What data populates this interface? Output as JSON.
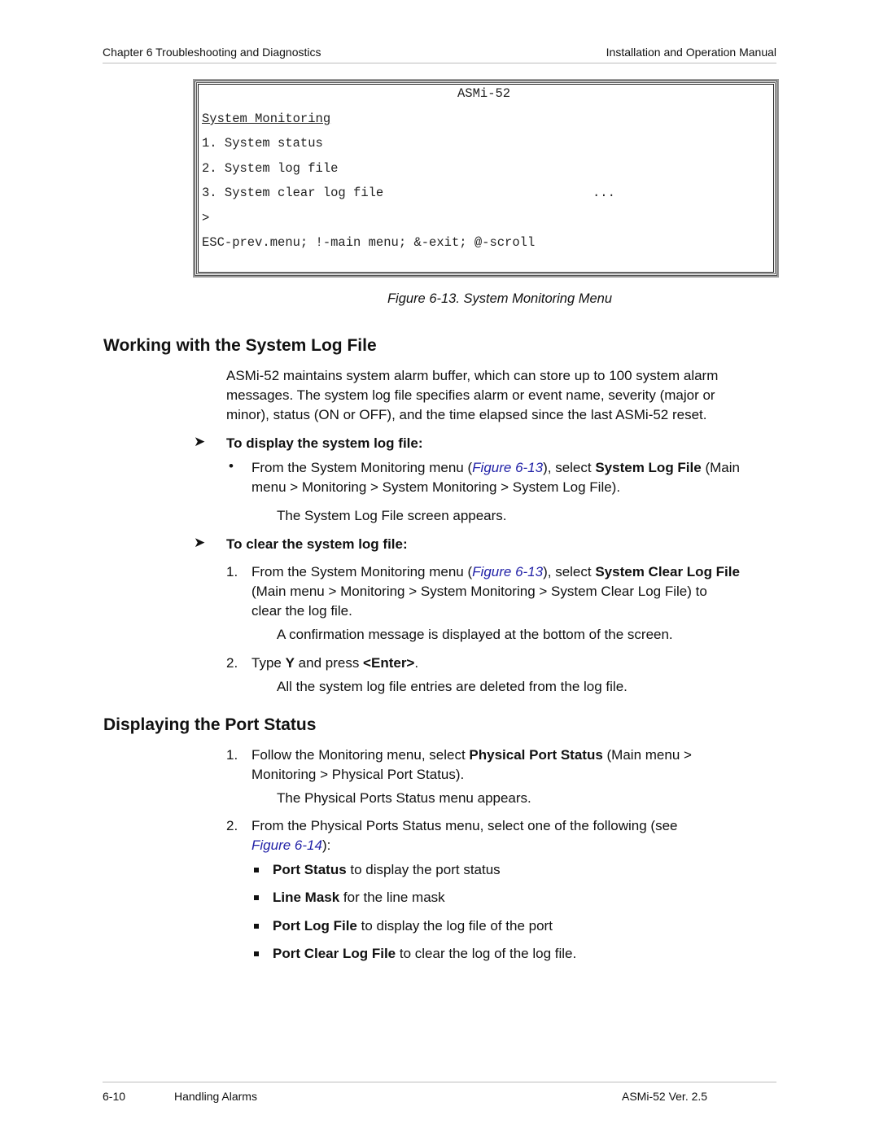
{
  "header": {
    "left": "Chapter 6  Troubleshooting and Diagnostics",
    "right": "Installation and Operation Manual"
  },
  "figure": {
    "terminal": {
      "title": "ASMi-52",
      "menu_title": "System Monitoring",
      "items": [
        "1. System status",
        "2. System log file",
        "3. System clear log file"
      ],
      "more_indicator": "...",
      "prompt": ">",
      "hint": "ESC-prev.menu; !-main menu; &-exit; @-scroll"
    },
    "caption": "Figure 6-13.  System Monitoring Menu"
  },
  "section1": {
    "heading": "Working with the System Log File",
    "intro": [
      "ASMi-52 maintains system alarm buffer, which can store up to 100 system alarm",
      "messages. The system log file specifies alarm or event name, severity (major or",
      "minor), status (ON or OFF), and the time elapsed since the last ASMi-52 reset."
    ],
    "proc1": {
      "title": "To display the system log file:",
      "bullet": {
        "pre": "From the System Monitoring menu (",
        "link": "Figure 6-13",
        "mid": "), select ",
        "bold": "System Log File",
        "post": " (Main",
        "line2": "menu > Monitoring > System Monitoring > System Log File)."
      },
      "result": "The System Log File screen appears."
    },
    "proc2": {
      "title": "To clear the system log file:",
      "step1": {
        "num": "1.",
        "pre": "From the System Monitoring menu (",
        "link": "Figure 6-13",
        "mid": "), select ",
        "bold": "System Clear Log File",
        "line2": "(Main menu > Monitoring > System Monitoring > System Clear Log File) to",
        "line3": "clear the log file.",
        "result": "A confirmation message is displayed at the bottom of the screen."
      },
      "step2": {
        "num": "2.",
        "pre": "Type ",
        "bold1": "Y",
        "mid": " and press ",
        "bold2": "<Enter>",
        "post": ".",
        "result": "All the system log file entries are deleted from the log file."
      }
    }
  },
  "section2": {
    "heading": "Displaying the Port Status",
    "step1": {
      "num": "1.",
      "pre": "Follow the Monitoring menu, select ",
      "bold": "Physical Port Status",
      "post": " (Main menu >",
      "line2": "Monitoring > Physical Port Status).",
      "result": "The Physical Ports Status menu appears."
    },
    "step2": {
      "num": "2.",
      "text": "From the Physical Ports Status menu, select one of the following (see",
      "link": "Figure 6-14",
      "post": "):"
    },
    "options": [
      {
        "bold": "Port Status",
        "text": " to display the port status"
      },
      {
        "bold": "Line Mask",
        "text": " for the line mask"
      },
      {
        "bold": "Port Log File",
        "text": " to display the log file of the port"
      },
      {
        "bold": "Port Clear Log File",
        "text": " to clear the log of the log file."
      }
    ]
  },
  "footer": {
    "page": "6-10",
    "section": "Handling Alarms",
    "version": "ASMi-52 Ver. 2.5"
  }
}
